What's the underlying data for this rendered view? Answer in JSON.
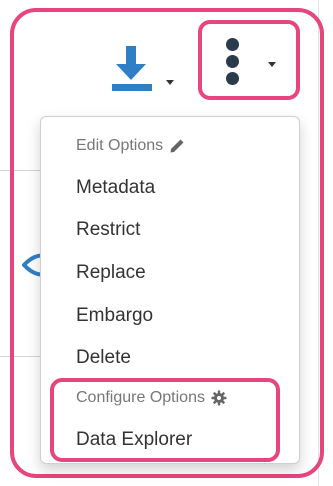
{
  "colors": {
    "highlight": "#e6457e",
    "download_icon": "#2f7fc6",
    "kebab": "#2a3b4d",
    "menu_text": "#333333",
    "header_text": "#777777"
  },
  "toolbar": {
    "download_icon": "download-icon",
    "options_icon": "vertical-ellipsis-icon"
  },
  "menu": {
    "edit_header": "Edit Options",
    "edit_icon": "pencil-icon",
    "items": [
      "Metadata",
      "Restrict",
      "Replace",
      "Embargo",
      "Delete"
    ],
    "config_header": "Configure Options",
    "config_icon": "gear-icon",
    "config_items": [
      "Data Explorer"
    ]
  }
}
